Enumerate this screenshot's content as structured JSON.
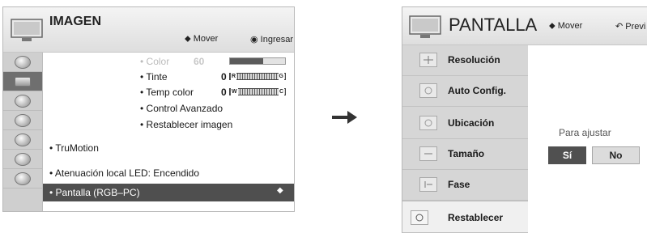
{
  "left_menu": {
    "title": "IMAGEN",
    "hint_move": "Mover",
    "hint_enter": "Ingresar",
    "items": [
      {
        "label": "• Color",
        "value": "60",
        "dim": true,
        "bar_fraction": 0.6
      },
      {
        "label": "• Tinte",
        "value": "0",
        "bar_left": "R",
        "bar_right": "G"
      },
      {
        "label": "• Temp color",
        "value": "0",
        "bar_left": "W",
        "bar_right": "C"
      },
      {
        "label": "• Control Avanzado"
      },
      {
        "label": "• Restablecer imagen"
      },
      {
        "label": "• TruMotion"
      },
      {
        "label": "• Pantalla (RGB–PC)",
        "selected": true
      },
      {
        "label": "• Atenuación local LED: Encendido"
      }
    ],
    "sidebar_icons": [
      "picture-icon",
      "screen-icon",
      "audio-icon",
      "time-icon",
      "lock-icon",
      "option-icon",
      "network-icon"
    ]
  },
  "right_menu": {
    "title": "PANTALLA",
    "hint_move": "Mover",
    "hint_prev": "Previ",
    "items": [
      {
        "label": "Resolución",
        "icon": "resolution-icon"
      },
      {
        "label": "Auto Config.",
        "icon": "auto-config-icon"
      },
      {
        "label": "Ubicación",
        "icon": "position-icon"
      },
      {
        "label": "Tamaño",
        "icon": "size-icon"
      },
      {
        "label": "Fase",
        "icon": "phase-icon"
      },
      {
        "label": "Restablecer",
        "icon": "reset-icon"
      }
    ],
    "adjust_label": "Para ajustar",
    "yes_label": "Sí",
    "no_label": "No"
  }
}
